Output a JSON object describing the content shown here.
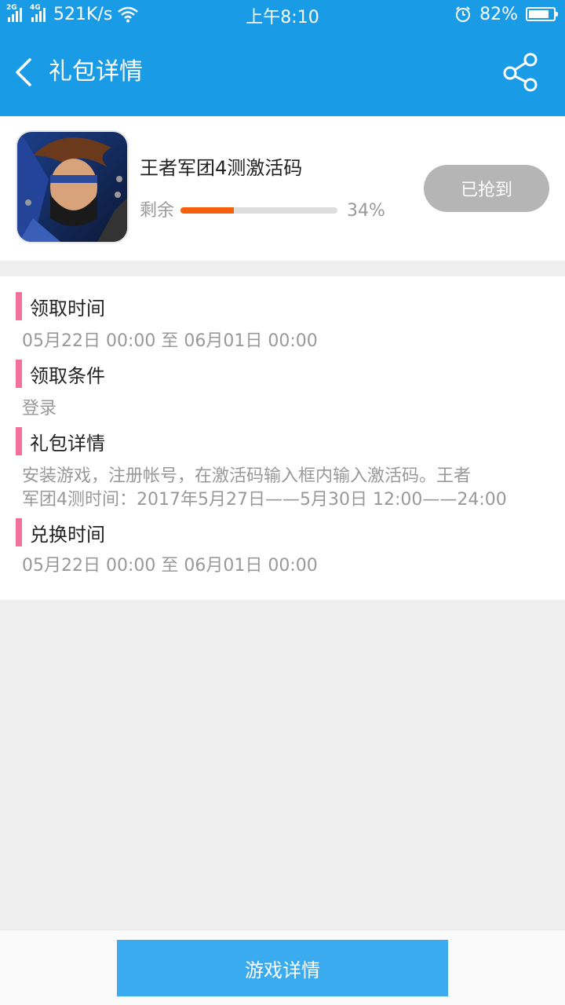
{
  "status_bar": {
    "network_1": "2G",
    "network_2": "4G",
    "speed": "521K/s",
    "time": "上午8:10",
    "battery": "82%",
    "battery_level": 0.82
  },
  "header": {
    "title": "礼包详情",
    "back_icon": "chevron-left-icon",
    "share_icon": "share-icon"
  },
  "gift": {
    "name": "王者军团4测激活码",
    "remain_label": "剩余",
    "remain_percent": "34%",
    "remain_fraction": 0.34,
    "claim_button": "已抢到",
    "colors": {
      "progress": "#f4600c",
      "button": "#b5b5b5"
    }
  },
  "sections": [
    {
      "title": "领取时间",
      "content": "05月22日 00:00 至 06月01日 00:00"
    },
    {
      "title": "领取条件",
      "content": "登录"
    },
    {
      "title": "礼包详情",
      "content_line1": "安装游戏，注册帐号，在激活码输入框内输入激活码。王者",
      "content_line2": "军团4测时间：2017年5月27日——5月30日 12:00——24:00"
    },
    {
      "title": "兑换时间",
      "content": "05月22日 00:00 至 06月01日 00:00"
    }
  ],
  "footer": {
    "button": "游戏详情"
  },
  "colors": {
    "primary": "#1a9be6",
    "accent_bar": "#f1719b",
    "footer_button": "#3aabef"
  }
}
